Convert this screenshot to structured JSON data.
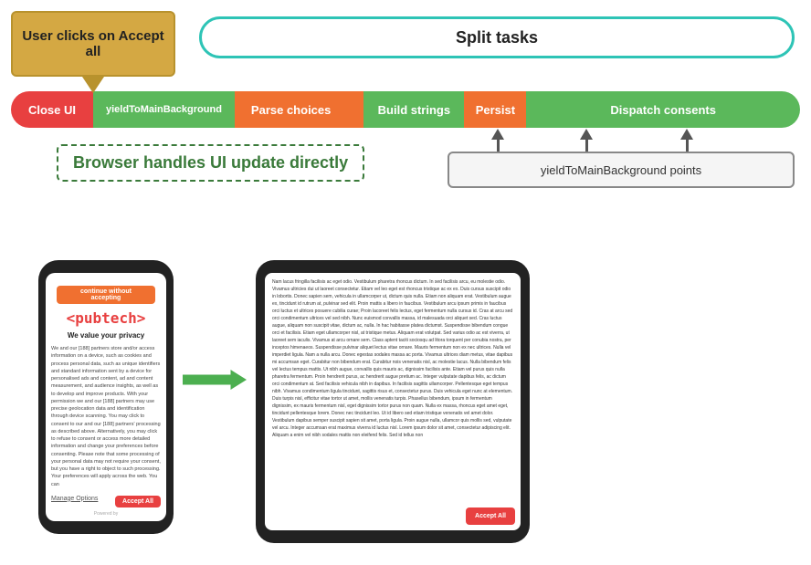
{
  "diagram": {
    "user_clicks_label": "User clicks on Accept all",
    "split_tasks_label": "Split tasks",
    "pipeline": {
      "close_ui": "Close UI",
      "yield_to_main": "yieldToMainBackground",
      "parse_choices": "Parse choices",
      "build_strings": "Build strings",
      "persist": "Persist",
      "dispatch_consents": "Dispatch consents"
    },
    "browser_handles": "Browser handles UI update directly",
    "yield_points_label": "yieldToMainBackground points"
  },
  "phone1": {
    "brand": "<pubtech>",
    "subtitle": "We value your privacy",
    "body_text": "We and our [188] partners store and/or access information on a device, such as cookies and process personal data, such as unique identifiers and standard information sent by a device for personalised ads and content, ad and content measurement, and audience insights, as well as to develop and improve products. With your permission we and our [188] partners may use precise geolocation data and identification through device scanning. You may click to consent to our and our [188] partners' processing as described above. Alternatively, you may click to refuse to consent or access more detailed information and change your preferences before consenting. Please note that some processing of your personal data may not require your consent, but you have a right to object to such processing. Your preferences will apply across the web. You can",
    "manage_options": "Manage Options",
    "accept_all": "Accept All",
    "powered_by": "Powered by"
  },
  "phone2": {
    "lorem": "Nam lacus fringilla facilisis ac eget odio. Vestibulum pharetra rhoncus dictum. In sed facilisis arcu, eu molestie odio. Vivamus ultricies dui ut laoreet consectetur. Etiam vel leo eget est rhoncus tristique ac ex ex. Duis cursus suscipit odio in lobortis. Donec sapien sem, vehicula in ullamcorper ut, dictum quis nulla. Etiam non aliquam erat. Vestibulum augue ex, tincidunt id rutrum at, pulvinar sed elit. Proin mattis a libero in faucibus. Vestibulum arcu ipsum primis in faucibus orci luctus et ultrices posuere cubilia curae; Proin lacoreet felis lectus, eget fermentum nulla cursus id. Cras at arcu sed orci condimentum ultrices vel sed nibh. Nunc euismod convallis massa, id malesuada orci aliquet sed. Cras luctus augue, aliquam non suscipit vitae, dictum ac, nulla. In hac habitasse platea dictumst. Suspendisse bibendum congue orci et facilisis. Etiam eget ullamcorper nisl, at tristique metus. Aliquam erat volutpat. Sed varius odio ac est viverra, ut laoreet sem iaculis. Vivamus at arcu ornare sem. Class aptent taciti sociosqu ad litora torquent per conubia nostra, per inceptos himenaeos. Suspendisse pulvinar aliquet lectus vitae ornare. Mauris fermentum non ex nec ultrices. Nulla vel imperdiet ligula. Nam a nulla arcu. Donec egestas sodales massa ac porta. Vivamus ultrices diam metus, vitae dapibus mi accumsan eget. Curabitur non bibendum erat. Curabitur nois venenatis nisl, ac molestie lacus. Nulla bibendum felis vel lectus tempus mattis. Ut nibh augue, convallis quis mauris ac, dignissim facilisis ante. Etiam vel purus quis nulla pharetra fermentum. Proin hendrerit purus, ac hendrerit augue pretium ac. Integer vulputate dapibus felis, ac dictum orci condimentum at. Sed facilisis vehicula nibh in dapibus. In facilisis sagittis ullamcorper. Pellentesque eget tempus nibh. Vivamus condimentum ligula tincidunt, sagittis risus et, consectetur purus. Duis vehicula eget nunc at elementum. Duis turpis nisl, efficitur vitae tortor ut amet, mollis venenatis turpis. Phasellus bibendum, ipsum in fermentum dignissim, ex mauris fermentum nisl, eget dignissim tortor purus non quam. Nulla ex massa, rhoncus eget amet eget, tincidunt pellentesque lorem. Donec nec tincidunt leo. Ut id libero sed etiam tristique venenatis vel amet dolor. Vestibulum dapibus semper suscipit sapien sit amet, porta ligula. Proin augue nulla, ullamcor quis mollis sed, vulputate vel arcu. Integer accumsan erat maximus viverra id luctus nisl. Lorem ipsum dolor sit amet, consectetur adipiscing elit. Aliquam a enim vel nibh sodales mattis non eleifend felis. Sed id tellus non",
    "accept_all_button": "Accept All"
  },
  "icons": {
    "arrow_right": "▶",
    "arrow_up": "↑",
    "arrow_down": "↓"
  }
}
